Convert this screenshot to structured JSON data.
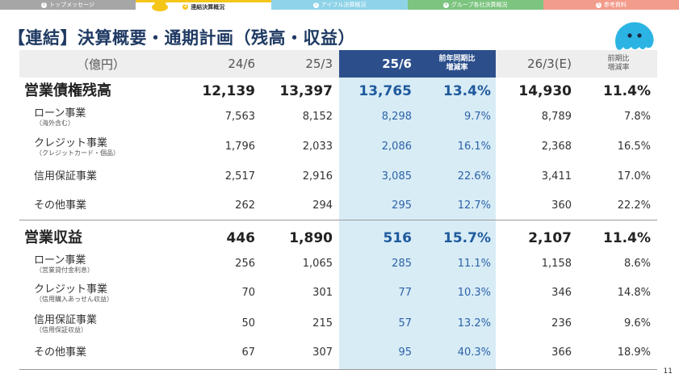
{
  "tabs": [
    {
      "num": "1",
      "label": "トップメッセージ"
    },
    {
      "num": "2",
      "label": "連結決算概況"
    },
    {
      "num": "3",
      "label": "アイフル決算概況"
    },
    {
      "num": "4",
      "label": "グループ各社決算概況"
    },
    {
      "num": "5",
      "label": "参考資料"
    }
  ],
  "title": "【連結】決算概要・通期計画（残高・収益）",
  "header": {
    "unit": "（億円）",
    "c1": "24/6",
    "c2": "25/3",
    "c3": "25/6",
    "c4_line1": "前年同期比",
    "c4_line2": "増減率",
    "c5": "26/3(E)",
    "c6_line1": "前期比",
    "c6_line2": "増減率"
  },
  "sections": [
    {
      "label": "営業債権残高",
      "values": [
        "12,139",
        "13,397",
        "13,765",
        "13.4%",
        "14,930",
        "11.4%"
      ],
      "rows": [
        {
          "label": "ローン事業",
          "sub": "（海外含む）",
          "values": [
            "7,563",
            "8,152",
            "8,298",
            "9.7%",
            "8,789",
            "7.8%"
          ]
        },
        {
          "label": "クレジット事業",
          "sub": "（クレジットカード・個品）",
          "values": [
            "1,796",
            "2,033",
            "2,086",
            "16.1%",
            "2,368",
            "16.5%"
          ]
        },
        {
          "label": "信用保証事業",
          "sub": "",
          "values": [
            "2,517",
            "2,916",
            "3,085",
            "22.6%",
            "3,411",
            "17.0%"
          ]
        },
        {
          "label": "その他事業",
          "sub": "",
          "values": [
            "262",
            "294",
            "295",
            "12.7%",
            "360",
            "22.2%"
          ]
        }
      ]
    },
    {
      "label": "営業収益",
      "values": [
        "446",
        "1,890",
        "516",
        "15.7%",
        "2,107",
        "11.4%"
      ],
      "rows": [
        {
          "label": "ローン事業",
          "sub": "（営業貸付金利息）",
          "values": [
            "256",
            "1,065",
            "285",
            "11.1%",
            "1,158",
            "8.6%"
          ]
        },
        {
          "label": "クレジット事業",
          "sub": "（信用購入あっせん収益）",
          "values": [
            "70",
            "301",
            "77",
            "10.3%",
            "346",
            "14.8%"
          ]
        },
        {
          "label": "信用保証事業",
          "sub": "（信用保証収益）",
          "values": [
            "50",
            "215",
            "57",
            "13.2%",
            "236",
            "9.6%"
          ]
        },
        {
          "label": "その他事業",
          "sub": "",
          "values": [
            "67",
            "307",
            "95",
            "40.3%",
            "366",
            "18.9%"
          ]
        }
      ]
    }
  ],
  "page_number": "11",
  "colors": {
    "title": "#1f3a63",
    "highlight": "#d8ecf6",
    "header_dark": "#2c4f8c",
    "accent_yellow": "#f5c518"
  }
}
